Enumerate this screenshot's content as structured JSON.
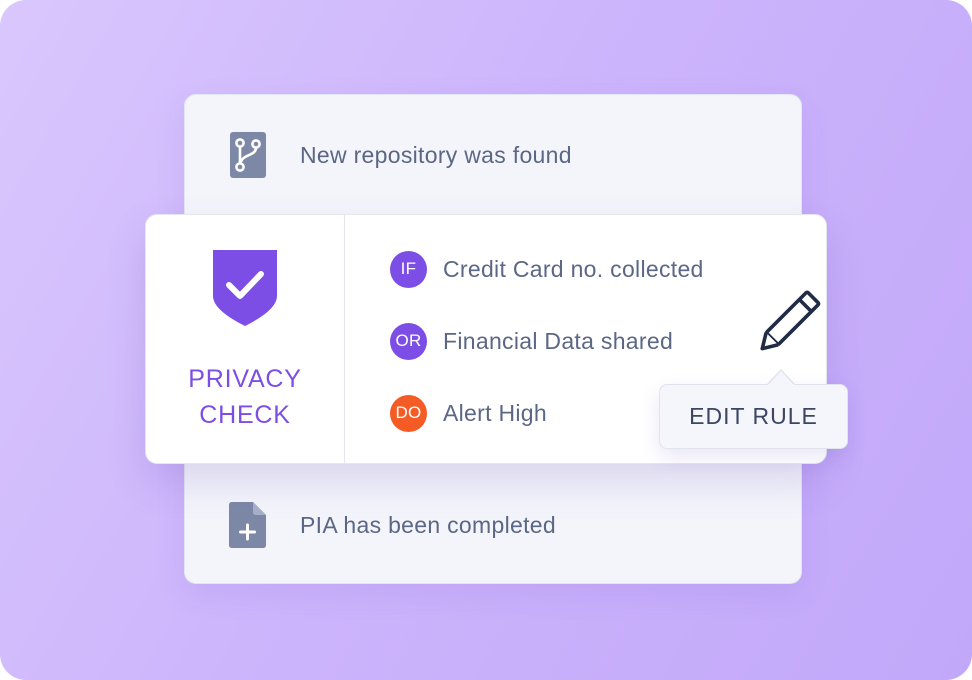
{
  "feed": {
    "top_event": {
      "icon": "git-branch-icon",
      "text": "New repository was found"
    },
    "bottom_event": {
      "icon": "file-add-icon",
      "text": "PIA has been completed"
    }
  },
  "privacy_check": {
    "icon": "shield-check-icon",
    "title_line1": "PRIVACY",
    "title_line2": "CHECK"
  },
  "conditions": [
    {
      "badge": "IF",
      "label": "Credit Card no. collected",
      "color": "#7c4ee6"
    },
    {
      "badge": "OR",
      "label": "Financial Data shared",
      "color": "#7c4ee6"
    },
    {
      "badge": "DO",
      "label": "Alert High",
      "color": "#f45b25"
    }
  ],
  "edit": {
    "icon": "pencil-icon",
    "button_label": "EDIT RULE"
  },
  "colors": {
    "accent": "#7c4ee6",
    "alert": "#f45b25",
    "text": "#5b6784",
    "icon_gray": "#7d88a6"
  }
}
